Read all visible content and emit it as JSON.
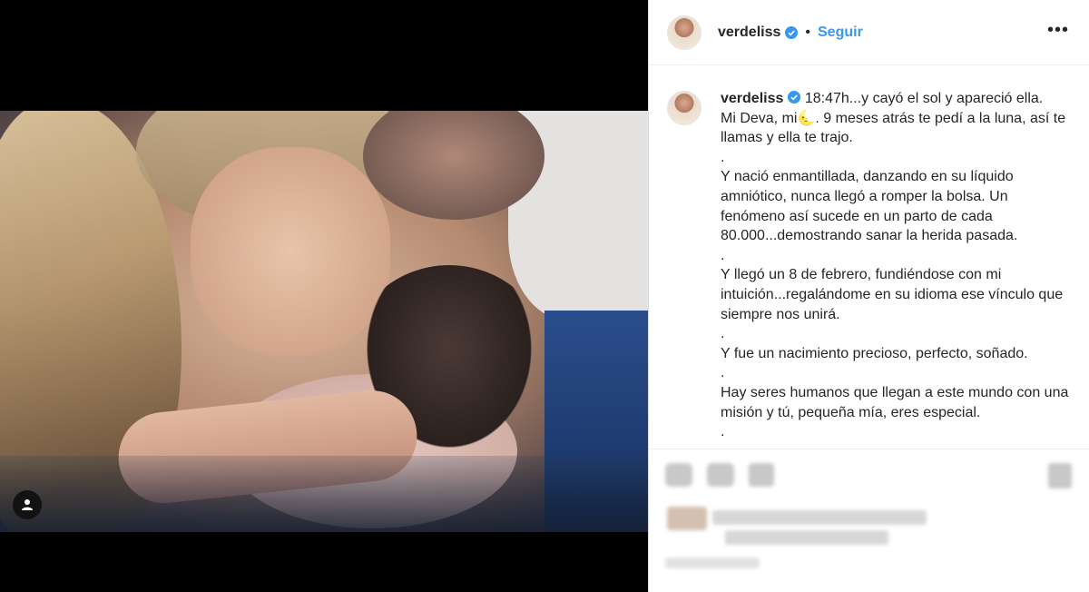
{
  "post": {
    "username": "verdeliss",
    "separator": "•",
    "follow_label": "Seguir",
    "more_label": "•••",
    "caption_username": "verdeliss",
    "caption_lines": [
      "18:47h...y cayó el sol y apareció ella.",
      "Mi Deva, mi🌜. 9 meses atrás te pedí a la luna, así te llamas y ella te trajo.",
      ".",
      "Y nació enmantillada, danzando en su líquido amniótico, nunca llegó a romper la bolsa. Un fenómeno así sucede en un parto de cada 80.000...demostrando sanar la herida pasada.",
      ".",
      "Y llegó un 8 de febrero, fundiéndose con mi intuición...regalándome en su idioma ese vínculo que siempre nos unirá.",
      ".",
      "Y fue un nacimiento precioso, perfecto, soñado.",
      ".",
      "Hay seres humanos que llegan a este mundo con una misión y tú, pequeña mía, eres especial.",
      "."
    ]
  },
  "icons": {
    "verified": "verified-badge-icon",
    "more": "more-options-icon",
    "tag": "user-tag-icon",
    "like": "heart-icon",
    "comment": "comment-icon",
    "share": "share-icon",
    "save": "bookmark-icon"
  },
  "colors": {
    "accent": "#3897f0",
    "text": "#262626",
    "border": "#dbdbdb"
  }
}
